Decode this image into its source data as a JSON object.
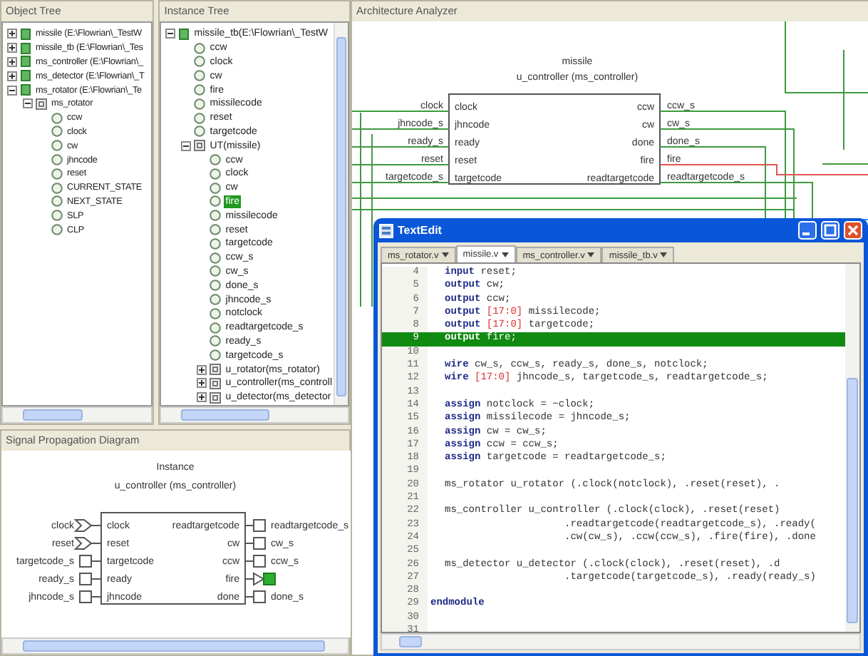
{
  "object_tree": {
    "title": "Object Tree",
    "items": [
      {
        "label": "missile (E:\\Flowrian\\_TestW",
        "kind": "file",
        "expanded": false,
        "selected": false
      },
      {
        "label": "missile_tb (E:\\Flowrian\\_Tes",
        "kind": "file",
        "expanded": false,
        "selected": false
      },
      {
        "label": "ms_controller (E:\\Flowrian\\_",
        "kind": "file",
        "expanded": false,
        "selected": false
      },
      {
        "label": "ms_detector (E:\\Flowrian\\_T",
        "kind": "file",
        "expanded": false,
        "selected": false
      },
      {
        "label": "ms_rotator (E:\\Flowrian\\_Te",
        "kind": "file",
        "expanded": true,
        "selected": false,
        "children": [
          {
            "label": "ms_rotator",
            "kind": "module",
            "expanded": true,
            "selected": false,
            "children": [
              {
                "label": "ccw",
                "kind": "port",
                "selected": false
              },
              {
                "label": "clock",
                "kind": "port",
                "selected": false
              },
              {
                "label": "cw",
                "kind": "port",
                "selected": false
              },
              {
                "label": "jhncode",
                "kind": "port",
                "selected": false
              },
              {
                "label": "reset",
                "kind": "port",
                "selected": false
              },
              {
                "label": "CURRENT_STATE",
                "kind": "port",
                "selected": false
              },
              {
                "label": "NEXT_STATE",
                "kind": "port",
                "selected": false
              },
              {
                "label": "SLP",
                "kind": "port",
                "selected": false
              },
              {
                "label": "CLP",
                "kind": "port",
                "selected": false
              }
            ]
          }
        ]
      }
    ]
  },
  "instance_tree": {
    "title": "Instance Tree",
    "items": [
      {
        "label": "missile_tb(E:\\Flowrian\\_TestW",
        "kind": "file",
        "expanded": true,
        "selected": false,
        "children": [
          {
            "label": "ccw",
            "kind": "port",
            "selected": false
          },
          {
            "label": "clock",
            "kind": "port",
            "selected": false
          },
          {
            "label": "cw",
            "kind": "port",
            "selected": false
          },
          {
            "label": "fire",
            "kind": "port",
            "selected": false
          },
          {
            "label": "missilecode",
            "kind": "port",
            "selected": false
          },
          {
            "label": "reset",
            "kind": "port",
            "selected": false
          },
          {
            "label": "targetcode",
            "kind": "port",
            "selected": false
          },
          {
            "label": "UT(missile)",
            "kind": "module",
            "expanded": true,
            "selected": false,
            "children": [
              {
                "label": "ccw",
                "kind": "port",
                "selected": false
              },
              {
                "label": "clock",
                "kind": "port",
                "selected": false
              },
              {
                "label": "cw",
                "kind": "port",
                "selected": false
              },
              {
                "label": "fire",
                "kind": "port",
                "selected": true
              },
              {
                "label": "missilecode",
                "kind": "port",
                "selected": false
              },
              {
                "label": "reset",
                "kind": "port",
                "selected": false
              },
              {
                "label": "targetcode",
                "kind": "port",
                "selected": false
              },
              {
                "label": "ccw_s",
                "kind": "port",
                "selected": false
              },
              {
                "label": "cw_s",
                "kind": "port",
                "selected": false
              },
              {
                "label": "done_s",
                "kind": "port",
                "selected": false
              },
              {
                "label": "jhncode_s",
                "kind": "port",
                "selected": false
              },
              {
                "label": "notclock",
                "kind": "port",
                "selected": false
              },
              {
                "label": "readtargetcode_s",
                "kind": "port",
                "selected": false
              },
              {
                "label": "ready_s",
                "kind": "port",
                "selected": false
              },
              {
                "label": "targetcode_s",
                "kind": "port",
                "selected": false
              },
              {
                "label": "u_rotator(ms_rotator)",
                "kind": "module",
                "expanded": false,
                "selected": false
              },
              {
                "label": "u_controller(ms_controll",
                "kind": "module",
                "expanded": false,
                "selected": false
              },
              {
                "label": "u_detector(ms_detector",
                "kind": "module",
                "expanded": false,
                "selected": false
              }
            ]
          }
        ]
      }
    ]
  },
  "signal_diagram": {
    "title": "Signal Propagation Diagram",
    "heading": "Instance",
    "block": "u_controller (ms_controller)",
    "inputs": [
      {
        "port": "clock",
        "net": "clock",
        "kind": "merge"
      },
      {
        "port": "reset",
        "net": "reset",
        "kind": "merge"
      },
      {
        "port": "targetcode",
        "net": "targetcode_s",
        "kind": "box"
      },
      {
        "port": "ready",
        "net": "ready_s",
        "kind": "box"
      },
      {
        "port": "jhncode",
        "net": "jhncode_s",
        "kind": "box"
      }
    ],
    "outputs": [
      {
        "port": "readtargetcode",
        "net": "readtargetcode_s",
        "highlighted": false
      },
      {
        "port": "cw",
        "net": "cw_s",
        "highlighted": false
      },
      {
        "port": "ccw",
        "net": "ccw_s",
        "highlighted": false
      },
      {
        "port": "fire",
        "highlighted": true
      },
      {
        "port": "done",
        "net": "done_s",
        "highlighted": false
      }
    ]
  },
  "architecture": {
    "title": "Architecture Analyzer",
    "instance": "missile",
    "block": "u_controller (ms_controller)",
    "inputs": [
      {
        "port": "clock",
        "net": "clock"
      },
      {
        "port": "jhncode",
        "net": "jhncode_s"
      },
      {
        "port": "ready",
        "net": "ready_s"
      },
      {
        "port": "reset",
        "net": "reset"
      },
      {
        "port": "targetcode",
        "net": "targetcode_s"
      }
    ],
    "outputs": [
      {
        "port": "ccw",
        "net": "ccw_s",
        "highlighted": false
      },
      {
        "port": "cw",
        "net": "cw_s",
        "highlighted": false
      },
      {
        "port": "done",
        "net": "done_s",
        "highlighted": false
      },
      {
        "port": "fire",
        "net": "fire",
        "highlighted": true
      },
      {
        "port": "readtargetcode",
        "net": "readtargetcode_s",
        "highlighted": false
      }
    ]
  },
  "text_edit": {
    "title": "TextEdit",
    "tabs": [
      {
        "label": "ms_rotator.v",
        "selected": false
      },
      {
        "label": "missile.v",
        "selected": true
      },
      {
        "label": "ms_controller.v",
        "selected": false
      },
      {
        "label": "missile_tb.v",
        "selected": false
      }
    ],
    "lines": [
      {
        "n": "4",
        "keyword": "input",
        "text": "reset;",
        "highlighted": false
      },
      {
        "n": "5",
        "keyword": "output",
        "text": "cw;",
        "highlighted": false
      },
      {
        "n": "6",
        "keyword": "output",
        "text": "ccw;",
        "highlighted": false
      },
      {
        "n": "7",
        "keyword": "output",
        "range": "[17:0]",
        "text": "missilecode;",
        "highlighted": false
      },
      {
        "n": "8",
        "keyword": "output",
        "range": "[17:0]",
        "text": "targetcode;",
        "highlighted": false
      },
      {
        "n": "9",
        "keyword": "output",
        "text": "fire;",
        "highlighted": true
      },
      {
        "n": "10",
        "highlighted": false
      },
      {
        "n": "11",
        "keyword": "wire",
        "text": "cw_s, ccw_s, ready_s, done_s, notclock;",
        "highlighted": false
      },
      {
        "n": "12",
        "keyword": "wire",
        "range": "[17:0]",
        "text": "jhncode_s, targetcode_s, readtargetcode_s;",
        "highlighted": false
      },
      {
        "n": "13",
        "highlighted": false
      },
      {
        "n": "14",
        "keyword": "assign",
        "text": "notclock = ~clock;",
        "highlighted": false
      },
      {
        "n": "15",
        "keyword": "assign",
        "text": "missilecode = jhncode_s;",
        "highlighted": false
      },
      {
        "n": "16",
        "keyword": "assign",
        "text": "cw = cw_s;",
        "highlighted": false
      },
      {
        "n": "17",
        "keyword": "assign",
        "text": "ccw = ccw_s;",
        "highlighted": false
      },
      {
        "n": "18",
        "keyword": "assign",
        "text": "targetcode = readtargetcode_s;",
        "highlighted": false
      },
      {
        "n": "19",
        "highlighted": false
      },
      {
        "n": "20",
        "text": "ms_rotator u_rotator (.clock(notclock), .reset(reset), .",
        "highlighted": false
      },
      {
        "n": "21",
        "highlighted": false
      },
      {
        "n": "22",
        "text": "ms_controller u_controller (.clock(clock), .reset(reset)",
        "highlighted": false
      },
      {
        "n": "23",
        "text": ".readtargetcode(readtargetcode_s), .ready(",
        "continuation": true,
        "highlighted": false
      },
      {
        "n": "24",
        "text": ".cw(cw_s), .ccw(ccw_s), .fire(fire), .done",
        "continuation": true,
        "highlighted": false
      },
      {
        "n": "25",
        "highlighted": false
      },
      {
        "n": "26",
        "text": "ms_detector u_detector (.clock(clock), .reset(reset), .d",
        "highlighted": false
      },
      {
        "n": "27",
        "text": ".targetcode(targetcode_s), .ready(ready_s)",
        "continuation": true,
        "highlighted": false
      },
      {
        "n": "28",
        "highlighted": false
      },
      {
        "n": "29",
        "keyword": "endmodule",
        "outdent": true,
        "highlighted": false
      },
      {
        "n": "30",
        "highlighted": false
      },
      {
        "n": "31",
        "highlighted": false
      }
    ]
  }
}
